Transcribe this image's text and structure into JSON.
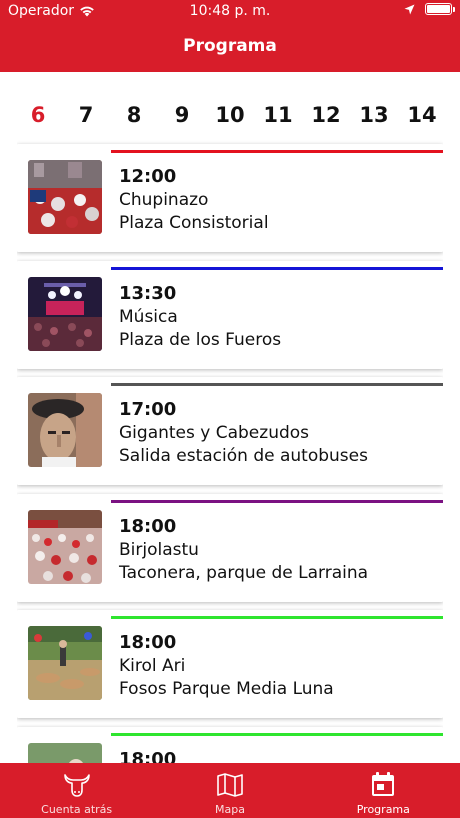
{
  "status_bar": {
    "carrier": "Operador",
    "time": "10:48 p. m."
  },
  "header": {
    "title": "Programa"
  },
  "days": {
    "selected": "6",
    "items": [
      "6",
      "7",
      "8",
      "9",
      "10",
      "11",
      "12",
      "13",
      "14"
    ]
  },
  "events": [
    {
      "time": "12:00",
      "name": "Chupinazo",
      "place": "Plaza Consistorial",
      "color": "#e3121f",
      "image": "crowd-red-photo"
    },
    {
      "time": "13:30",
      "name": "Música",
      "place": "Plaza de los Fueros",
      "color": "#1414d6",
      "image": "concert-stage-photo"
    },
    {
      "time": "17:00",
      "name": "Gigantes y Cabezudos",
      "place": "Salida estación de autobuses",
      "color": "#555555",
      "image": "giant-head-photo"
    },
    {
      "time": "18:00",
      "name": "Birjolastu",
      "place": "Taconera, parque de Larraina",
      "color": "#7b1282",
      "image": "street-crowd-photo"
    },
    {
      "time": "18:00",
      "name": "Kirol Ari",
      "place": "Fosos Parque Media Luna",
      "color": "#2ee52e",
      "image": "rural-sport-photo"
    },
    {
      "time": "18:00",
      "name": "",
      "place": "",
      "color": "#2ee52e",
      "image": "event-photo"
    }
  ],
  "tabbar": {
    "tabs": [
      {
        "label": "Cuenta atrás",
        "icon": "bull-icon"
      },
      {
        "label": "Mapa",
        "icon": "map-icon"
      },
      {
        "label": "Programa",
        "icon": "calendar-icon"
      }
    ],
    "active": "Programa"
  },
  "colors": {
    "brand": "#d81d2a",
    "active_day": "#d81d2a"
  }
}
